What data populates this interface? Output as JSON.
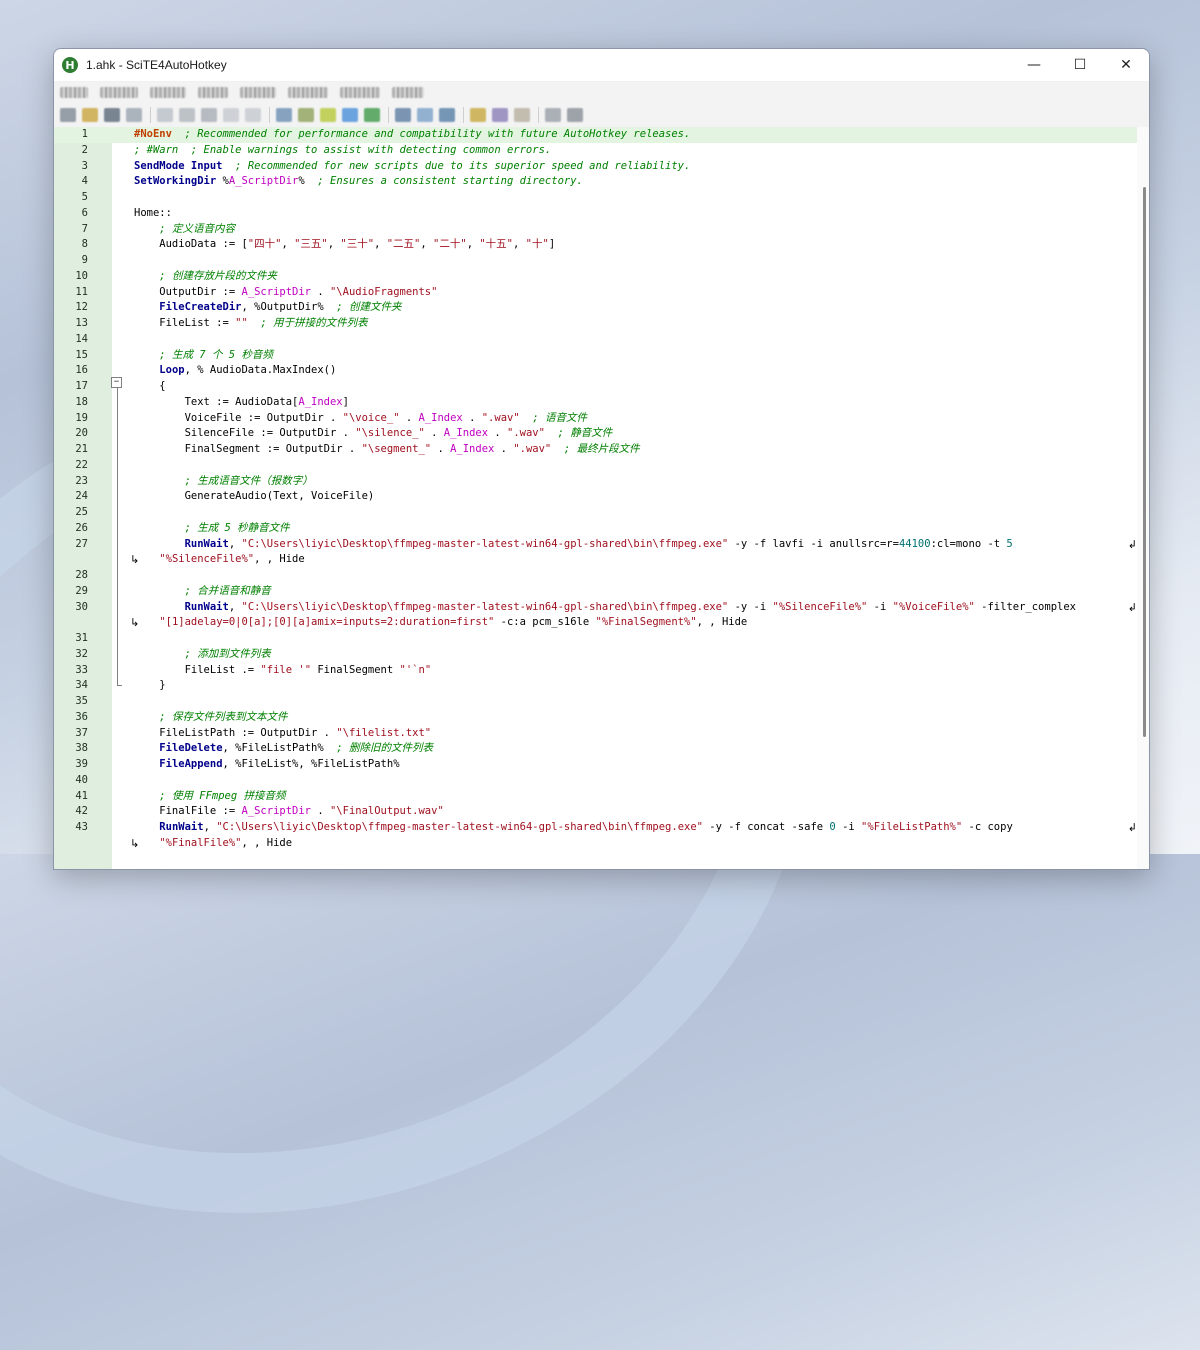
{
  "window": {
    "title": "1.ahk - SciTE4AutoHotkey",
    "app_icon_letter": "H"
  },
  "window_controls": {
    "minimize": "—",
    "maximize": "☐",
    "close": "✕"
  },
  "menu_items": [
    "blurred",
    "blurred",
    "blurred",
    "blurred",
    "blurred",
    "blurred",
    "blurred",
    "blurred"
  ],
  "editor": {
    "lines": [
      {
        "n": "1",
        "code": [
          [
            "dir",
            "#NoEnv"
          ],
          [
            "",
            "  "
          ],
          [
            "cm",
            "; Recommended for performance and compatibility with future AutoHotkey releases."
          ]
        ]
      },
      {
        "n": "2",
        "code": [
          [
            "cm",
            "; #Warn  ; Enable warnings to assist with detecting common errors."
          ]
        ]
      },
      {
        "n": "3",
        "code": [
          [
            "cmd",
            "SendMode Input"
          ],
          [
            "",
            "  "
          ],
          [
            "cm",
            "; Recommended for new scripts due to its superior speed and reliability."
          ]
        ]
      },
      {
        "n": "4",
        "code": [
          [
            "cmd",
            "SetWorkingDir"
          ],
          [
            "",
            "",
            " %"
          ],
          [
            "bvar",
            "A_ScriptDir"
          ],
          [
            "",
            "%  "
          ],
          [
            "cm",
            "; Ensures a consistent starting directory."
          ]
        ]
      },
      {
        "n": "5",
        "code": []
      },
      {
        "n": "6",
        "code": [
          [
            "",
            "Home::"
          ]
        ]
      },
      {
        "n": "7",
        "code": [
          [
            "",
            "    "
          ],
          [
            "cm",
            "; 定义语音内容"
          ]
        ]
      },
      {
        "n": "8",
        "code": [
          [
            "",
            "    AudioData := ["
          ],
          [
            "str",
            "\"四十\""
          ],
          [
            "",
            ", "
          ],
          [
            "str",
            "\"三五\""
          ],
          [
            "",
            ", "
          ],
          [
            "str",
            "\"三十\""
          ],
          [
            "",
            ", "
          ],
          [
            "str",
            "\"二五\""
          ],
          [
            "",
            ", "
          ],
          [
            "str",
            "\"二十\""
          ],
          [
            "",
            ", "
          ],
          [
            "str",
            "\"十五\""
          ],
          [
            "",
            ", "
          ],
          [
            "str",
            "\"十\""
          ],
          [
            "",
            "]"
          ]
        ]
      },
      {
        "n": "9",
        "code": []
      },
      {
        "n": "10",
        "code": [
          [
            "",
            "    "
          ],
          [
            "cm",
            "; 创建存放片段的文件夹"
          ]
        ]
      },
      {
        "n": "11",
        "code": [
          [
            "",
            "    OutputDir := "
          ],
          [
            "bvar",
            "A_ScriptDir"
          ],
          [
            "",
            " . "
          ],
          [
            "str",
            "\"\\AudioFragments\""
          ]
        ]
      },
      {
        "n": "12",
        "code": [
          [
            "",
            "    "
          ],
          [
            "cmd",
            "FileCreateDir"
          ],
          [
            "",
            ", %OutputDir%  "
          ],
          [
            "cm",
            "; 创建文件夹"
          ]
        ]
      },
      {
        "n": "13",
        "code": [
          [
            "",
            "    FileList := "
          ],
          [
            "str",
            "\"\""
          ],
          [
            "",
            "  "
          ],
          [
            "cm",
            "; 用于拼接的文件列表"
          ]
        ]
      },
      {
        "n": "14",
        "code": []
      },
      {
        "n": "15",
        "code": [
          [
            "",
            "    "
          ],
          [
            "cm",
            "; 生成 7 个 5 秒音频"
          ]
        ]
      },
      {
        "n": "16",
        "code": [
          [
            "",
            "    "
          ],
          [
            "cmd",
            "Loop"
          ],
          [
            "",
            ", % AudioData.MaxIndex()"
          ]
        ]
      },
      {
        "n": "17",
        "code": [
          [
            "",
            "    {"
          ]
        ]
      },
      {
        "n": "18",
        "code": [
          [
            "",
            "        Text := AudioData["
          ],
          [
            "bvar",
            "A_Index"
          ],
          [
            "",
            "]"
          ]
        ]
      },
      {
        "n": "19",
        "code": [
          [
            "",
            "        VoiceFile := OutputDir . "
          ],
          [
            "str",
            "\"\\voice_\""
          ],
          [
            "",
            " . "
          ],
          [
            "bvar",
            "A_Index"
          ],
          [
            "",
            " . "
          ],
          [
            "str",
            "\".wav\""
          ],
          [
            "",
            "  "
          ],
          [
            "cm",
            "; 语音文件"
          ]
        ]
      },
      {
        "n": "20",
        "code": [
          [
            "",
            "        SilenceFile := OutputDir . "
          ],
          [
            "str",
            "\"\\silence_\""
          ],
          [
            "",
            " . "
          ],
          [
            "bvar",
            "A_Index"
          ],
          [
            "",
            " . "
          ],
          [
            "str",
            "\".wav\""
          ],
          [
            "",
            "  "
          ],
          [
            "cm",
            "; 静音文件"
          ]
        ]
      },
      {
        "n": "21",
        "code": [
          [
            "",
            "        FinalSegment := OutputDir . "
          ],
          [
            "str",
            "\"\\segment_\""
          ],
          [
            "",
            " . "
          ],
          [
            "bvar",
            "A_Index"
          ],
          [
            "",
            " . "
          ],
          [
            "str",
            "\".wav\""
          ],
          [
            "",
            "  "
          ],
          [
            "cm",
            "; 最终片段文件"
          ]
        ]
      },
      {
        "n": "22",
        "code": []
      },
      {
        "n": "23",
        "code": [
          [
            "",
            "        "
          ],
          [
            "cm",
            "; 生成语音文件（报数字）"
          ]
        ]
      },
      {
        "n": "24",
        "code": [
          [
            "",
            "        GenerateAudio(Text, VoiceFile)"
          ]
        ]
      },
      {
        "n": "25",
        "code": []
      },
      {
        "n": "26",
        "code": [
          [
            "",
            "        "
          ],
          [
            "cm",
            "; 生成 5 秒静音文件"
          ]
        ]
      },
      {
        "n": "27",
        "wrap": true,
        "code": [
          [
            "",
            "        "
          ],
          [
            "cmd",
            "RunWait"
          ],
          [
            "",
            ", "
          ],
          [
            "str",
            "\"C:\\Users\\liyic\\Desktop\\ffmpeg-master-latest-win64-gpl-shared\\bin\\ffmpeg.exe\""
          ],
          [
            "",
            " -y -f lavfi -i anullsrc=r="
          ],
          [
            "num",
            "44100"
          ],
          [
            "",
            ":cl=mono -t "
          ],
          [
            "num",
            "5"
          ]
        ]
      },
      {
        "n": "",
        "cont": true,
        "code": [
          [
            "",
            "    "
          ],
          [
            "str",
            "\"%SilenceFile%\""
          ],
          [
            "",
            ", , Hide"
          ]
        ]
      },
      {
        "n": "28",
        "code": []
      },
      {
        "n": "29",
        "code": [
          [
            "",
            "        "
          ],
          [
            "cm",
            "; 合并语音和静音"
          ]
        ]
      },
      {
        "n": "30",
        "wrap": true,
        "code": [
          [
            "",
            "        "
          ],
          [
            "cmd",
            "RunWait"
          ],
          [
            "",
            ", "
          ],
          [
            "str",
            "\"C:\\Users\\liyic\\Desktop\\ffmpeg-master-latest-win64-gpl-shared\\bin\\ffmpeg.exe\""
          ],
          [
            "",
            " -y -i "
          ],
          [
            "str",
            "\"%SilenceFile%\""
          ],
          [
            "",
            " -i "
          ],
          [
            "str",
            "\"%VoiceFile%\""
          ],
          [
            "",
            " -filter_complex"
          ]
        ]
      },
      {
        "n": "",
        "cont": true,
        "code": [
          [
            "",
            "    "
          ],
          [
            "str",
            "\"[1]adelay=0|0[a];[0][a]amix=inputs=2:duration=first\""
          ],
          [
            "",
            " -c:a pcm_s16le "
          ],
          [
            "str",
            "\"%FinalSegment%\""
          ],
          [
            "",
            ", , Hide"
          ]
        ]
      },
      {
        "n": "31",
        "code": []
      },
      {
        "n": "32",
        "code": [
          [
            "",
            "        "
          ],
          [
            "cm",
            "; 添加到文件列表"
          ]
        ]
      },
      {
        "n": "33",
        "code": [
          [
            "",
            "        FileList .= "
          ],
          [
            "str",
            "\"file '\""
          ],
          [
            "",
            " FinalSegment "
          ],
          [
            "str",
            "\"'`n\""
          ]
        ]
      },
      {
        "n": "34",
        "code": [
          [
            "",
            "    }"
          ]
        ]
      },
      {
        "n": "35",
        "code": []
      },
      {
        "n": "36",
        "code": [
          [
            "",
            "    "
          ],
          [
            "cm",
            "; 保存文件列表到文本文件"
          ]
        ]
      },
      {
        "n": "37",
        "code": [
          [
            "",
            "    FileListPath := OutputDir . "
          ],
          [
            "str",
            "\"\\filelist.txt\""
          ]
        ]
      },
      {
        "n": "38",
        "code": [
          [
            "",
            "    "
          ],
          [
            "cmd",
            "FileDelete"
          ],
          [
            "",
            ", %FileListPath%  "
          ],
          [
            "cm",
            "; 删除旧的文件列表"
          ]
        ]
      },
      {
        "n": "39",
        "code": [
          [
            "",
            "    "
          ],
          [
            "cmd",
            "FileAppend"
          ],
          [
            "",
            ", %FileList%, %FileListPath%"
          ]
        ]
      },
      {
        "n": "40",
        "code": []
      },
      {
        "n": "41",
        "code": [
          [
            "",
            "    "
          ],
          [
            "cm",
            "; 使用 FFmpeg 拼接音频"
          ]
        ]
      },
      {
        "n": "42",
        "code": [
          [
            "",
            "    FinalFile := "
          ],
          [
            "bvar",
            "A_ScriptDir"
          ],
          [
            "",
            " . "
          ],
          [
            "str",
            "\"\\FinalOutput.wav\""
          ]
        ]
      },
      {
        "n": "43",
        "wrap": true,
        "code": [
          [
            "",
            "    "
          ],
          [
            "cmd",
            "RunWait"
          ],
          [
            "",
            ", "
          ],
          [
            "str",
            "\"C:\\Users\\liyic\\Desktop\\ffmpeg-master-latest-win64-gpl-shared\\bin\\ffmpeg.exe\""
          ],
          [
            "",
            " -y -f concat -safe "
          ],
          [
            "num",
            "0"
          ],
          [
            "",
            " -i "
          ],
          [
            "str",
            "\"%FileListPath%\""
          ],
          [
            "",
            " -c copy"
          ]
        ]
      },
      {
        "n": "",
        "cont": true,
        "code": [
          [
            "",
            "    "
          ],
          [
            "str",
            "\"%FinalFile%\""
          ],
          [
            "",
            ", , Hide"
          ]
        ]
      }
    ]
  },
  "colors": {
    "gutter": "#dfeede",
    "caret_line": "#e3f5e0",
    "comment": "#008000",
    "string": "#a0101f",
    "command": "#00008b"
  }
}
